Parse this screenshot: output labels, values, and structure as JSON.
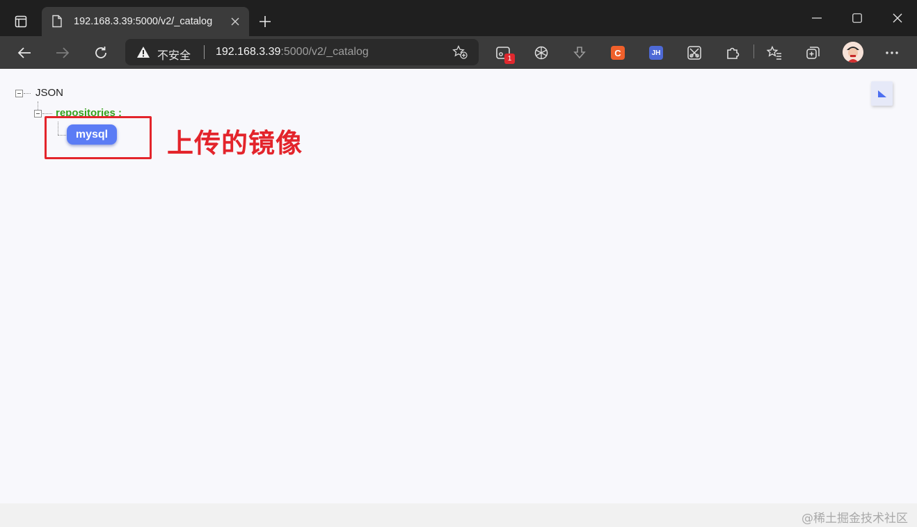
{
  "browser": {
    "tab": {
      "title": "192.168.3.39:5000/v2/_catalog"
    },
    "address_bar": {
      "security_label": "不安全",
      "url_host": "192.168.3.39",
      "url_path": ":5000/v2/_catalog"
    },
    "extensions": {
      "badge_count": "1",
      "c_label": "C",
      "jh_label": "JH"
    }
  },
  "page": {
    "tree": {
      "root_label": "JSON",
      "key_label": "repositories :",
      "items": [
        "mysql"
      ]
    },
    "annotation": "上传的镜像",
    "annotation_color": "#e3242b",
    "watermark": "@稀土掘金技术社区"
  },
  "colors": {
    "pill": "#5b7cf5",
    "key": "#36a21e"
  }
}
